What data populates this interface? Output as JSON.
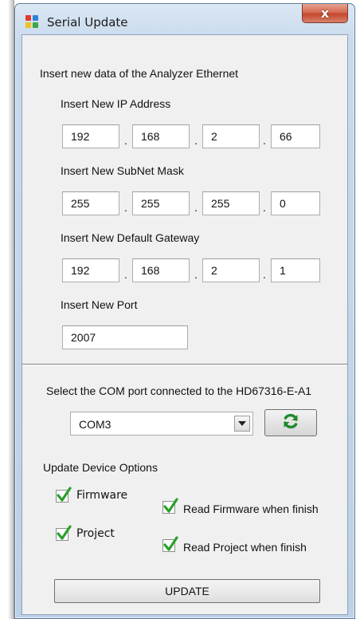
{
  "window": {
    "title": "Serial Update",
    "close_symbol": "x",
    "accent": "#c4462c"
  },
  "ethernet": {
    "heading": "Insert new data of the Analyzer Ethernet",
    "ip": {
      "label": "Insert New IP Address",
      "octets": [
        "192",
        "168",
        "2",
        "66"
      ]
    },
    "subnet": {
      "label": "Insert New SubNet Mask",
      "octets": [
        "255",
        "255",
        "255",
        "0"
      ]
    },
    "gateway": {
      "label": "Insert New Default Gateway",
      "octets": [
        "192",
        "168",
        "2",
        "1"
      ]
    },
    "port": {
      "label": "Insert New Port",
      "value": "2007"
    },
    "separator": "."
  },
  "com": {
    "label": "Select the COM port connected to the HD67316-E-A1",
    "selected": "COM3",
    "refresh_icon": "refresh-icon",
    "dropdown_icon": "chevron-down-icon"
  },
  "options": {
    "heading": "Update Device Options",
    "firmware": {
      "label": "Firmware",
      "checked": true
    },
    "project": {
      "label": "Project",
      "checked": true
    },
    "read_firmware": {
      "label": "Read Firmware when finish",
      "checked": true
    },
    "read_project": {
      "label": "Read Project when finish",
      "checked": true
    },
    "check_color": "#2aa02a"
  },
  "update_label": "UPDATE"
}
